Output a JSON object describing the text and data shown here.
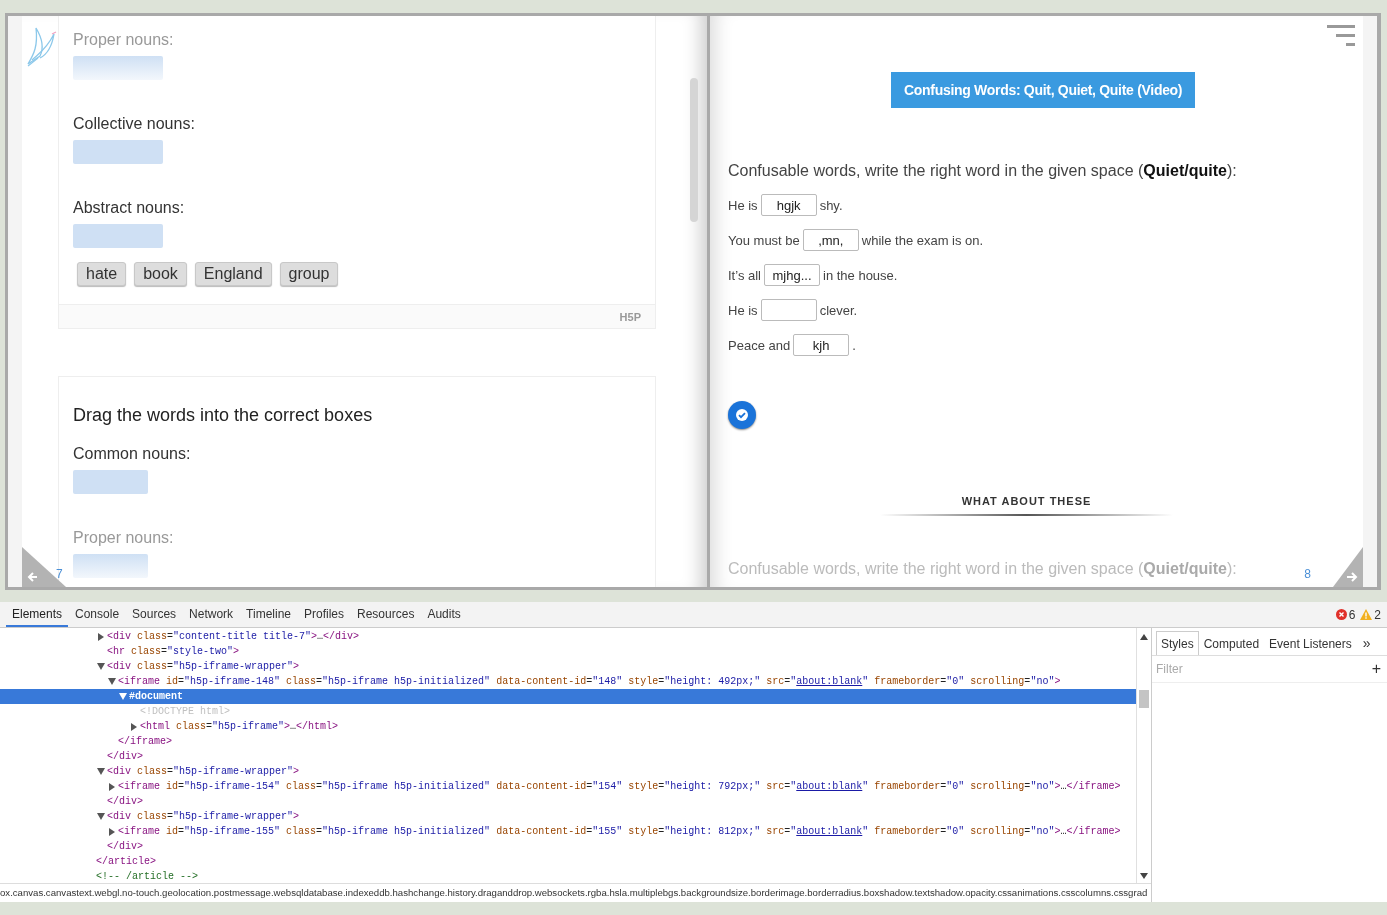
{
  "book": {
    "left_page": {
      "page_number": "7",
      "cards": [
        {
          "groups": [
            {
              "label": "Proper nouns:",
              "faded": true
            },
            {
              "label": "Collective nouns:",
              "faded": false
            },
            {
              "label": "Abstract nouns:",
              "faded": false
            }
          ],
          "words": [
            "hate",
            "book",
            "England",
            "group"
          ],
          "footer_logo": "H5P"
        },
        {
          "title": "Drag the words into the correct boxes",
          "groups": [
            {
              "label": "Common nouns:",
              "faded": false
            },
            {
              "label": "Proper nouns:",
              "faded": true
            }
          ]
        }
      ]
    },
    "right_page": {
      "page_number": "8",
      "video_button": "Confusing Words: Quit, Quiet, Quite (Video)",
      "instruction": "Confusable words, write the right word in the given space (**Quiet/quite**):",
      "sentences": [
        {
          "before": "He is",
          "value": "hgjk",
          "after": "shy."
        },
        {
          "before": "You must be",
          "value": ",mn,",
          "after": "while the exam is on."
        },
        {
          "before": "It’s all",
          "value": "mjhg...",
          "after": "in the house."
        },
        {
          "before": "He is",
          "after": "clever."
        },
        {
          "before": "Peace and",
          "value": "kjh",
          "after": "."
        }
      ],
      "section_heading": "WHAT ABOUT THESE",
      "next_instruction": "Confusable words, write the right word in the given space (**Quiet/quite**):"
    }
  },
  "devtools": {
    "tabs": [
      {
        "label": "Elements",
        "selected": true
      },
      {
        "label": "Console",
        "selected": false
      },
      {
        "label": "Sources",
        "selected": false
      },
      {
        "label": "Network",
        "selected": false
      },
      {
        "label": "Timeline",
        "selected": false
      },
      {
        "label": "Profiles",
        "selected": false
      },
      {
        "label": "Resources",
        "selected": false
      },
      {
        "label": "Audits",
        "selected": false
      }
    ],
    "errors": "6",
    "warnings": "2",
    "tree": [
      {
        "children": [
          {
            "expanded": false,
            "selected": false,
            "tokens": [
              {
                "tag": "<div"
              },
              {
                "attr": " class"
              },
              {
                "eq": "="
              },
              {
                "value": "\"content-title title-7\""
              },
              {
                "tag": ">"
              },
              {
                "text": "…"
              },
              {
                "tag": "</div>"
              }
            ]
          },
          {
            "selected": false,
            "tokens": [
              {
                "tag": "<hr"
              },
              {
                "attr": " class"
              },
              {
                "eq": "="
              },
              {
                "value": "\"style-two\""
              },
              {
                "tag": ">"
              }
            ]
          },
          {
            "expanded": true,
            "selected": false,
            "tokens": [
              {
                "tag": "<div"
              },
              {
                "attr": " class"
              },
              {
                "eq": "="
              },
              {
                "value": "\"h5p-iframe-wrapper\""
              },
              {
                "tag": ">"
              }
            ],
            "close": [
              {
                "tag": "</div>"
              }
            ],
            "children": [
              {
                "expanded": true,
                "selected": false,
                "tokens": [
                  {
                    "tag": "<iframe"
                  },
                  {
                    "attr": " id"
                  },
                  {
                    "eq": "="
                  },
                  {
                    "value": "\"h5p-iframe-148\""
                  },
                  {
                    "attr": " class"
                  },
                  {
                    "eq": "="
                  },
                  {
                    "value": "\"h5p-iframe h5p-initialized\""
                  },
                  {
                    "attr": " data-content-id"
                  },
                  {
                    "eq": "="
                  },
                  {
                    "value": "\"148\""
                  },
                  {
                    "attr": " style"
                  },
                  {
                    "eq": "="
                  },
                  {
                    "value": "\"height: 492px;\""
                  },
                  {
                    "attr": " src"
                  },
                  {
                    "eq": "="
                  },
                  {
                    "value": "\""
                  },
                  {
                    "link": "about:blank"
                  },
                  {
                    "value": "\""
                  },
                  {
                    "attr": " frameborder"
                  },
                  {
                    "eq": "="
                  },
                  {
                    "value": "\"0\""
                  },
                  {
                    "attr": " scrolling"
                  },
                  {
                    "eq": "="
                  },
                  {
                    "value": "\"no\""
                  },
                  {
                    "tag": ">"
                  }
                ],
                "close": [
                  {
                    "tag": "</iframe>"
                  }
                ],
                "children": [
                  {
                    "expanded": true,
                    "selected": true,
                    "tokens": [
                      {
                        "text": "#document"
                      }
                    ],
                    "children": [
                      {
                        "selected": false,
                        "tokens": [
                          {
                            "doctype": "<!DOCTYPE html>"
                          }
                        ]
                      },
                      {
                        "expanded": false,
                        "selected": false,
                        "tokens": [
                          {
                            "tag": "<html"
                          },
                          {
                            "attr": " class"
                          },
                          {
                            "eq": "="
                          },
                          {
                            "value": "\"h5p-iframe\""
                          },
                          {
                            "tag": ">"
                          },
                          {
                            "text": "…"
                          },
                          {
                            "tag": "</html>"
                          }
                        ]
                      }
                    ]
                  }
                ]
              }
            ]
          },
          {
            "expanded": true,
            "selected": false,
            "tokens": [
              {
                "tag": "<div"
              },
              {
                "attr": " class"
              },
              {
                "eq": "="
              },
              {
                "value": "\"h5p-iframe-wrapper\""
              },
              {
                "tag": ">"
              }
            ],
            "close": [
              {
                "tag": "</div>"
              }
            ],
            "children": [
              {
                "expanded": false,
                "selected": false,
                "tokens": [
                  {
                    "tag": "<iframe"
                  },
                  {
                    "attr": " id"
                  },
                  {
                    "eq": "="
                  },
                  {
                    "value": "\"h5p-iframe-154\""
                  },
                  {
                    "attr": " class"
                  },
                  {
                    "eq": "="
                  },
                  {
                    "value": "\"h5p-iframe h5p-initialized\""
                  },
                  {
                    "attr": " data-content-id"
                  },
                  {
                    "eq": "="
                  },
                  {
                    "value": "\"154\""
                  },
                  {
                    "attr": " style"
                  },
                  {
                    "eq": "="
                  },
                  {
                    "value": "\"height: 792px;\""
                  },
                  {
                    "attr": " src"
                  },
                  {
                    "eq": "="
                  },
                  {
                    "value": "\""
                  },
                  {
                    "link": "about:blank"
                  },
                  {
                    "value": "\""
                  },
                  {
                    "attr": " frameborder"
                  },
                  {
                    "eq": "="
                  },
                  {
                    "value": "\"0\""
                  },
                  {
                    "attr": " scrolling"
                  },
                  {
                    "eq": "="
                  },
                  {
                    "value": "\"no\""
                  },
                  {
                    "tag": ">"
                  },
                  {
                    "text": "…"
                  },
                  {
                    "tag": "</iframe>"
                  }
                ]
              }
            ]
          },
          {
            "expanded": true,
            "selected": false,
            "tokens": [
              {
                "tag": "<div"
              },
              {
                "attr": " class"
              },
              {
                "eq": "="
              },
              {
                "value": "\"h5p-iframe-wrapper\""
              },
              {
                "tag": ">"
              }
            ],
            "close": [
              {
                "tag": "</div>"
              }
            ],
            "children": [
              {
                "expanded": false,
                "selected": false,
                "tokens": [
                  {
                    "tag": "<iframe"
                  },
                  {
                    "attr": " id"
                  },
                  {
                    "eq": "="
                  },
                  {
                    "value": "\"h5p-iframe-155\""
                  },
                  {
                    "attr": " class"
                  },
                  {
                    "eq": "="
                  },
                  {
                    "value": "\"h5p-iframe h5p-initialized\""
                  },
                  {
                    "attr": " data-content-id"
                  },
                  {
                    "eq": "="
                  },
                  {
                    "value": "\"155\""
                  },
                  {
                    "attr": " style"
                  },
                  {
                    "eq": "="
                  },
                  {
                    "value": "\"height: 812px;\""
                  },
                  {
                    "attr": " src"
                  },
                  {
                    "eq": "="
                  },
                  {
                    "value": "\""
                  },
                  {
                    "link": "about:blank"
                  },
                  {
                    "value": "\""
                  },
                  {
                    "attr": " frameborder"
                  },
                  {
                    "eq": "="
                  },
                  {
                    "value": "\"0\""
                  },
                  {
                    "attr": " scrolling"
                  },
                  {
                    "eq": "="
                  },
                  {
                    "value": "\"no\""
                  },
                  {
                    "tag": ">"
                  },
                  {
                    "text": "…"
                  },
                  {
                    "tag": "</iframe>"
                  }
                ]
              }
            ]
          }
        ],
        "close": [
          {
            "tag": "</article>"
          }
        ]
      },
      {
        "selected": false,
        "tokens": [
          {
            "comment": "<!-- /article -->"
          }
        ]
      }
    ],
    "status_path": "ox.canvas.canvastext.webgl.no-touch.geolocation.postmessage.websqldatabase.indexeddb.hashchange.history.draganddrop.websockets.rgba.hsla.multiplebgs.backgroundsize.borderimage.borderradius.boxshadow.textshadow.opacity.cssanimations.csscolumns.cssgrad",
    "sidebar": {
      "tabs": [
        {
          "label": "Styles",
          "selected": true
        },
        {
          "label": "Computed",
          "selected": false
        },
        {
          "label": "Event Listeners",
          "selected": false
        }
      ],
      "more": "»",
      "filter_placeholder": "Filter",
      "add": "+"
    }
  }
}
